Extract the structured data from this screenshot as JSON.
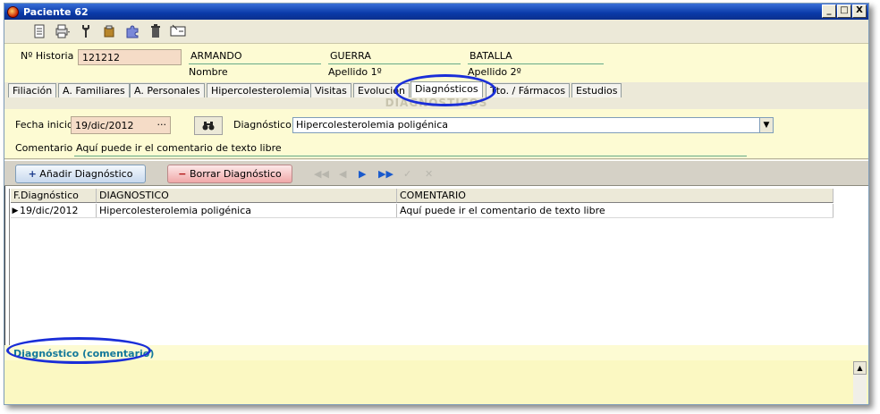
{
  "window": {
    "title": "Paciente 62",
    "buttons": {
      "minimize": "_",
      "maximize": "□",
      "close": "X"
    }
  },
  "toolbar": {
    "icons": [
      "document-icon",
      "print-icon",
      "tool-icon",
      "clipboard-icon",
      "puzzle-icon",
      "trash-icon",
      "exit-icon"
    ]
  },
  "patient": {
    "history_label": "Nº Historia",
    "history_value": "121212",
    "first_name": "ARMANDO",
    "first_name_label": "Nombre",
    "last_name_1": "GUERRA",
    "last_name_1_label": "Apellido 1º",
    "last_name_2": "BATALLA",
    "last_name_2_label": "Apellido 2º"
  },
  "tabs": [
    {
      "label": "Filiación"
    },
    {
      "label": "A. Familiares"
    },
    {
      "label": "A. Personales"
    },
    {
      "label": "Hipercolesterolemia"
    },
    {
      "label": "Visitas"
    },
    {
      "label": "Evolución"
    },
    {
      "label": "Diagnósticos",
      "active": true
    },
    {
      "label": "Tto. / Fármacos"
    },
    {
      "label": "Estudios"
    }
  ],
  "panel": {
    "title": "DIAGNÓSTICOS",
    "date_label": "Fecha inicio",
    "date_value": "19/dic/2012",
    "date_button": "···",
    "diagnosis_label": "Diagnóstico",
    "diagnosis_value": "Hipercolesterolemia poligénica",
    "comment_label": "Comentario",
    "comment_value": "Aquí puede ir el comentario de texto libre"
  },
  "actions": {
    "add_label": "Añadir Diagnóstico",
    "delete_label": "Borrar Diagnóstico"
  },
  "grid": {
    "columns": [
      "F.Diagnóstico",
      "DIAGNOSTICO",
      "COMENTARIO"
    ],
    "rows": [
      [
        "19/dic/2012",
        "Hipercolesterolemia poligénica",
        "Aquí puede ir el comentario de texto libre"
      ]
    ]
  },
  "bottom": {
    "title": "Diagnóstico (comentario)"
  },
  "colors": {
    "highlight": "#1a2ed8",
    "yellow_panel": "#fdfbd3",
    "title_bar": "#0a3aa8"
  }
}
